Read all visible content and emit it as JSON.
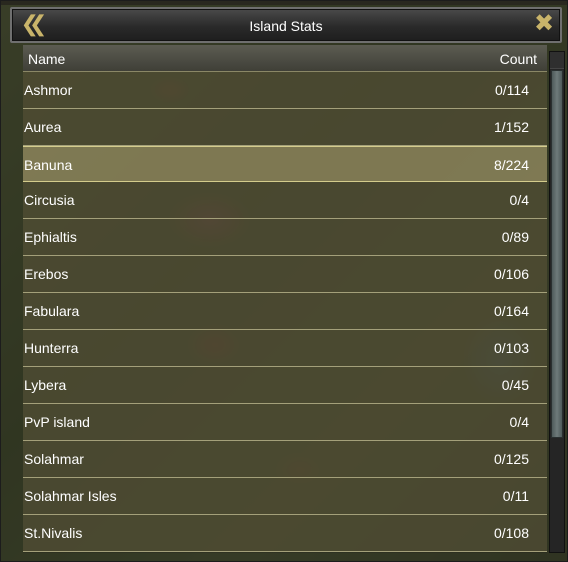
{
  "window": {
    "title": "Island Stats",
    "back_icon": "double-chevron-left-icon",
    "close_icon": "close-x-icon"
  },
  "table": {
    "columns": {
      "name": "Name",
      "count": "Count"
    },
    "rows": [
      {
        "name": "Ashmor",
        "count": "0/114"
      },
      {
        "name": "Aurea",
        "count": "1/152"
      },
      {
        "name": "Banuna",
        "count": "8/224"
      },
      {
        "name": "Circusia",
        "count": "0/4"
      },
      {
        "name": "Ephialtis",
        "count": "0/89"
      },
      {
        "name": "Erebos",
        "count": "0/106"
      },
      {
        "name": "Fabulara",
        "count": "0/164"
      },
      {
        "name": "Hunterra",
        "count": "0/103"
      },
      {
        "name": "Lybera",
        "count": "0/45"
      },
      {
        "name": "PvP island",
        "count": "0/4"
      },
      {
        "name": "Solahmar",
        "count": "0/125"
      },
      {
        "name": "Solahmar Isles",
        "count": "0/11"
      },
      {
        "name": "St.Nivalis",
        "count": "0/108"
      }
    ],
    "selected_row": "Banuna"
  },
  "colors": {
    "accent_gold": "#c9b46a",
    "row_bg": "#625c3e",
    "selected_row_bg": "#aaa06e"
  }
}
